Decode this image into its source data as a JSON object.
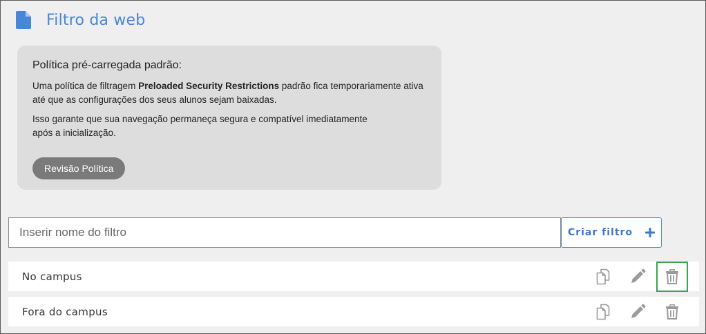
{
  "header": {
    "title": "Filtro da web",
    "icon": "document-icon",
    "accent": "#4a86d8"
  },
  "policy": {
    "title": "Política pré-carregada padrão:",
    "p1_before": "Uma política de filtragem ",
    "p1_bold": "Preloaded Security Restrictions",
    "p1_after": " padrão fica temporariamente ativa",
    "p1_line2": "até que as configurações dos seus alunos sejam baixadas.",
    "p2_line1": "Isso garante que sua navegação permaneça segura e compatível imediatamente",
    "p2_line2": "após a inicialização.",
    "review_button": "Revisão Política"
  },
  "filter_form": {
    "placeholder": "Inserir nome do filtro",
    "value": "",
    "create_button": "Criar filtro",
    "create_icon": "plus-icon"
  },
  "filters": [
    {
      "name": "No campus",
      "copy_icon": "copy-icon",
      "edit_icon": "pencil-icon",
      "delete_icon": "trash-icon",
      "delete_focused": true
    },
    {
      "name": "Fora do campus",
      "copy_icon": "copy-icon",
      "edit_icon": "pencil-icon",
      "delete_icon": "trash-icon",
      "delete_focused": false
    }
  ]
}
